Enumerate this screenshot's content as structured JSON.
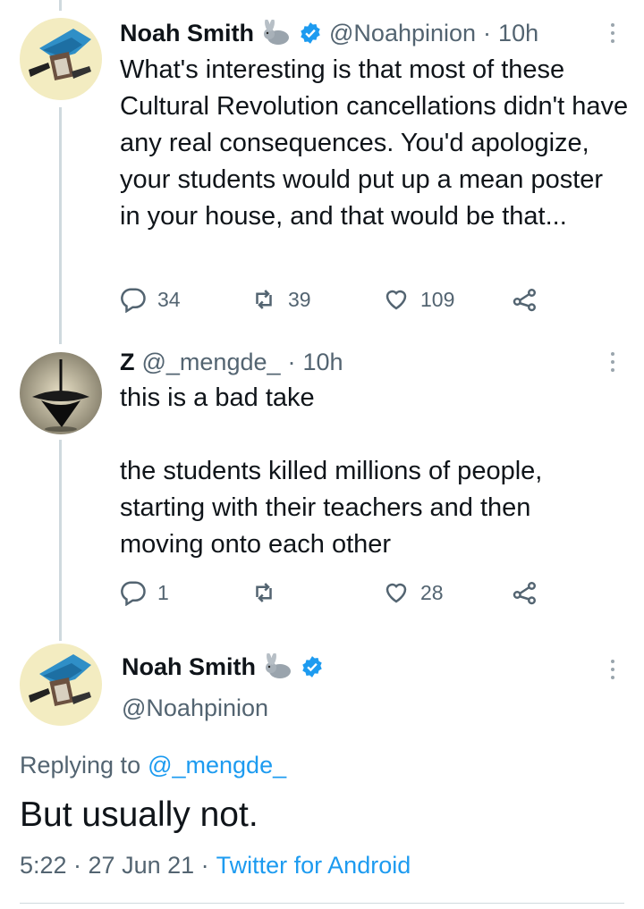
{
  "tweets": [
    {
      "name": "Noah Smith",
      "emoji": "🐇",
      "handle": "@Noahpinion",
      "time": "10h",
      "text": "What's interesting is that most of these Cultural Revolution cancellations didn't have any real consequences. You'd apologize, your students would put up a mean poster in your house, and that would be that...",
      "replies": "34",
      "retweets": "39",
      "likes": "109"
    },
    {
      "name": "Z",
      "handle": "@_mengde_",
      "time": "10h",
      "text_line1": "this is a bad take",
      "text_line2": "the students killed millions of people, starting with their teachers and then moving onto each other",
      "replies": "1",
      "retweets": "",
      "likes": "28"
    }
  ],
  "focused": {
    "name": "Noah Smith",
    "emoji": "🐇",
    "handle": "@Noahpinion",
    "replying_prefix": "Replying to",
    "replying_to": "@_mengde_",
    "text": "But usually not.",
    "timestamp": "5:22 · 27 Jun 21 ·",
    "client": "Twitter for Android"
  },
  "colors": {
    "accent": "#1d9bf0",
    "muted": "#536471",
    "thread_line": "#cfd9de"
  }
}
